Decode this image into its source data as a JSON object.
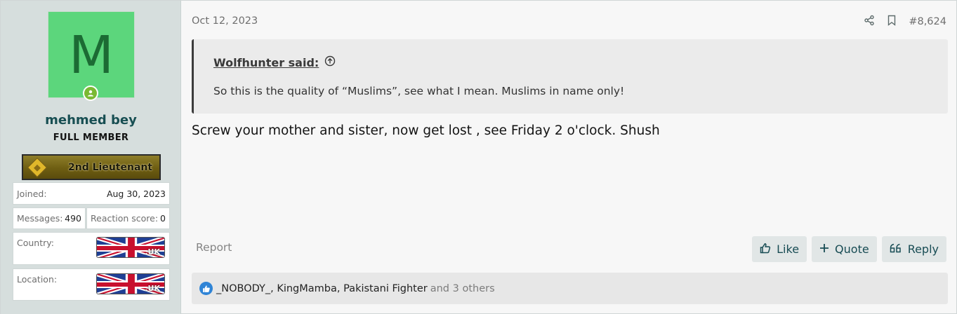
{
  "user": {
    "avatar_letter": "M",
    "avatar_color": "#5cd67c",
    "name": "mehmed bey",
    "title": "FULL MEMBER",
    "rank_banner": "2nd Lieutenant",
    "stats": {
      "joined_label": "Joined:",
      "joined_value": "Aug 30, 2023",
      "messages_label": "Messages:",
      "messages_value": "490",
      "reaction_label": "Reaction score:",
      "reaction_value": "0",
      "country_label": "Country:",
      "location_label": "Location:",
      "flag_text": ".UK"
    }
  },
  "post": {
    "date": "Oct 12, 2023",
    "number": "#8,624",
    "quote": {
      "author": "Wolfhunter said:",
      "text": "So this is the quality of “Muslims”, see what I mean. Muslims in name only!"
    },
    "body": "Screw your mother and sister, now get lost , see Friday 2 o'clock. Shush",
    "report_label": "Report",
    "buttons": {
      "like": "Like",
      "quote": "Quote",
      "reply": "Reply"
    },
    "reactions": {
      "users": [
        "_NOBODY_",
        "KingMamba",
        "Pakistani Fighter"
      ],
      "others": "and 3 others"
    }
  },
  "colors": {
    "accent": "#184c54",
    "username": "#174e52",
    "online": "#7ab933",
    "like": "#2f84d6"
  },
  "icons": [
    "share-icon",
    "bookmark-icon",
    "arrow-up-circle-icon",
    "thumbs-up-icon",
    "plus-icon",
    "reply-quote-icon",
    "online-user-icon"
  ]
}
